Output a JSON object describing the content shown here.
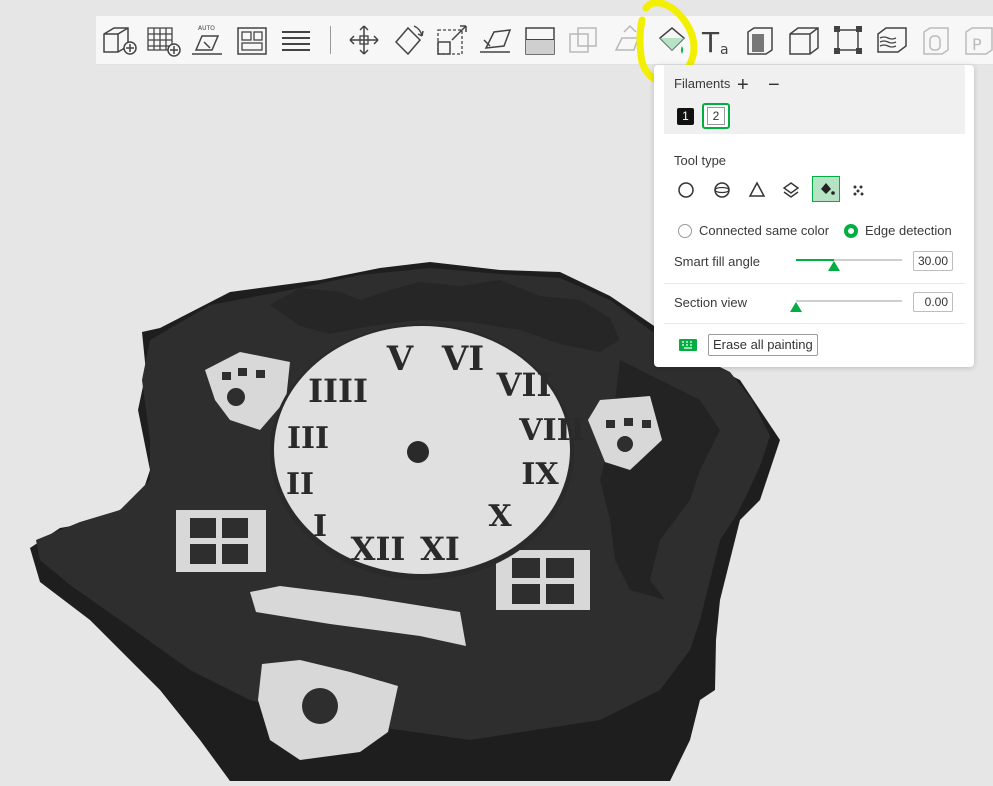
{
  "colors": {
    "accent": "#00ae42",
    "model": "#2b2b2b",
    "model_paint": "#dcdcdc",
    "highlight": "#f2ef00"
  },
  "toolbar": {
    "icons": [
      "add-icon",
      "arrange-grid-icon",
      "auto-orient-icon",
      "arrange-icon",
      "layers-icon",
      "move-icon",
      "rotate-icon",
      "scale-icon",
      "lay-on-face-icon",
      "cut-icon",
      "boolean-icon",
      "support-paint-icon",
      "color-paint-icon",
      "text-icon",
      "emboss-icon",
      "measure-icon",
      "assembly-icon",
      "fuzzy-skin-icon",
      "brim-ears-icon",
      "variable-layer-icon"
    ],
    "text_icon_glyph": "T",
    "text_icon_sub": "a"
  },
  "panel": {
    "filaments_label": "Filaments",
    "add_symbol": "+",
    "remove_symbol": "−",
    "filament_slots": [
      "1",
      "2"
    ],
    "selected_slot": "2",
    "tool_type_label": "Tool type",
    "tool_types": [
      "circle-tool-icon",
      "sphere-tool-icon",
      "triangle-tool-icon",
      "height-range-tool-icon",
      "fill-tool-icon",
      "gap-fill-tool-icon"
    ],
    "selected_tool": "fill-tool-icon",
    "fill_mode_connected": "Connected same color",
    "fill_mode_edge": "Edge detection",
    "selected_fill_mode": "Edge detection",
    "smart_fill_angle_label": "Smart fill angle",
    "smart_fill_angle_value": "30.00",
    "smart_fill_angle_fraction": 0.36,
    "section_view_label": "Section view",
    "section_view_value": "0.00",
    "section_view_fraction": 0.0,
    "erase_label": "Erase all painting",
    "keyboard_icon": "keyboard-icon"
  },
  "model": {
    "name": "cuckoo-clock-model",
    "numerals": [
      "I",
      "II",
      "III",
      "IIII",
      "V",
      "VI",
      "VII",
      "VIII",
      "IX",
      "X",
      "XI",
      "XII"
    ]
  }
}
